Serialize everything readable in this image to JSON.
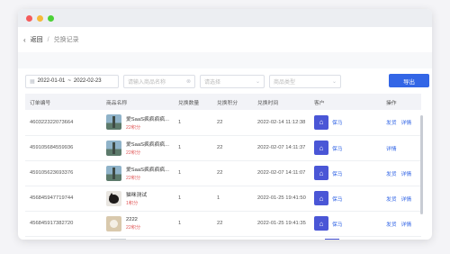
{
  "window": {
    "dots": [
      {
        "name": "close-dot",
        "color": "#f45b5b"
      },
      {
        "name": "minimize-dot",
        "color": "#f6b93b"
      },
      {
        "name": "zoom-dot",
        "color": "#4cd137"
      }
    ]
  },
  "breadcrumb": {
    "back": "返回",
    "sep": "/",
    "current": "兑换记录"
  },
  "filters": {
    "date_start": "2022-01-01",
    "date_sep": "~",
    "date_end": "2022-02-23",
    "product_placeholder": "请输入商品名称",
    "channel_placeholder": "请选择",
    "type_placeholder": "商品类型",
    "export_label": "导出"
  },
  "table": {
    "headers": [
      "订单编号",
      "商品名称",
      "兑换数量",
      "兑换积分",
      "兑换时间",
      "客户",
      "操作"
    ],
    "rows": [
      {
        "order": "460322322073664",
        "product": "爱SaaS疯疯疯疯...",
        "points_label": "22积分",
        "qty": "1",
        "points": "22",
        "time": "2022-02-14 11:12:38",
        "customer": "保马",
        "actions": [
          "发货",
          "详情"
        ],
        "thumb": "landscape"
      },
      {
        "order": "459105684559936",
        "product": "爱SaaS疯疯疯疯...",
        "points_label": "22积分",
        "qty": "1",
        "points": "22",
        "time": "2022-02-07 14:11:37",
        "customer": "保马",
        "actions": [
          "详情"
        ],
        "thumb": "landscape"
      },
      {
        "order": "459105623693376",
        "product": "爱SaaS疯疯疯疯...",
        "points_label": "22积分",
        "qty": "1",
        "points": "22",
        "time": "2022-02-07 14:11:07",
        "customer": "保马",
        "actions": [
          "发货",
          "详情"
        ],
        "thumb": "landscape"
      },
      {
        "order": "456845947719744",
        "product": "猫咪测试",
        "points_label": "1积分",
        "qty": "1",
        "points": "1",
        "time": "2022-01-25 19:41:50",
        "customer": "保马",
        "actions": [
          "发货",
          "详情"
        ],
        "thumb": "cat"
      },
      {
        "order": "456845917382720",
        "product": "2222",
        "points_label": "22积分",
        "qty": "1",
        "points": "22",
        "time": "2022-01-25 19:41:35",
        "customer": "保马",
        "actions": [
          "发货",
          "详情"
        ],
        "thumb": "bear"
      }
    ]
  },
  "colors": {
    "accent": "#3366e6",
    "customer_icon": "#4a56d6",
    "points_red": "#e05555"
  },
  "icons": {
    "customer": "shopping-bag-icon",
    "calendar": "calendar-icon",
    "back": "chevron-left-icon"
  }
}
